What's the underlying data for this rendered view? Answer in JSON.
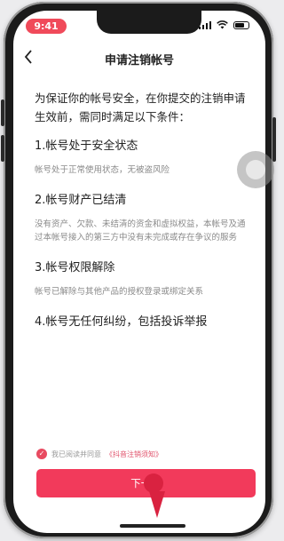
{
  "status_bar": {
    "time": "9:41"
  },
  "nav": {
    "back_icon": "chevron-left-icon",
    "title": "申请注销帐号"
  },
  "intro": "为保证你的帐号安全，在你提交的注销申请生效前，需同时满足以下条件：",
  "conditions": [
    {
      "title": "1.帐号处于安全状态",
      "desc": "帐号处于正常使用状态，无被盗风险"
    },
    {
      "title": "2.帐号财产已结清",
      "desc": "没有资产、欠款、未结清的资金和虚拟权益，本帐号及通过本帐号接入的第三方中没有未完成或存在争议的服务"
    },
    {
      "title": "3.帐号权限解除",
      "desc": "帐号已解除与其他产品的授权登录或绑定关系"
    },
    {
      "title": "4.帐号无任何纠纷，包括投诉举报",
      "desc": ""
    }
  ],
  "agreement": {
    "text": "我已阅读并同意",
    "link": "《抖音注销须知》",
    "checked": true
  },
  "next_button": {
    "label": "下一步"
  },
  "colors": {
    "accent": "#f23a5b",
    "time_pill": "#f04a5a"
  }
}
